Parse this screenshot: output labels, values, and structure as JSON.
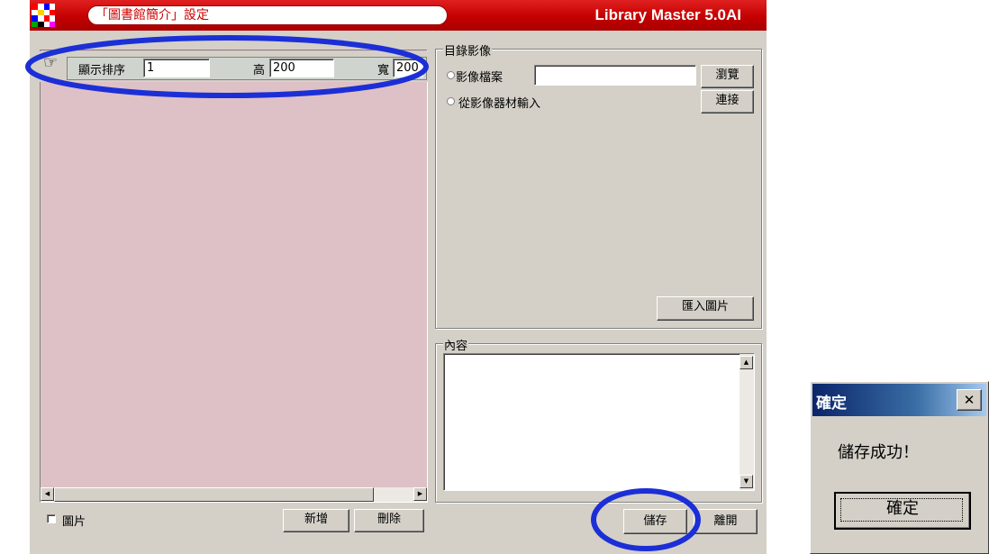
{
  "title_bar": {
    "tab_title": "「圖書館簡介」設定",
    "app_name": "Library Master 5.0AI"
  },
  "toolbar_row": {
    "order_label": "顯示排序",
    "order_value": "1",
    "height_label": "高",
    "height_value": "200",
    "width_label": "寬",
    "width_value": "200"
  },
  "left_panel": {
    "picture_checkbox_label": "圖片",
    "add_button": "新增",
    "delete_button": "刪除"
  },
  "catalog_image": {
    "legend": "目錄影像",
    "option_file": "影像檔案",
    "file_value": "",
    "browse_button": "瀏覽",
    "option_device": "從影像器材輸入",
    "connect_button": "連接",
    "import_button": "匯入圖片"
  },
  "content": {
    "legend": "內容",
    "text": ""
  },
  "footer": {
    "save_button": "儲存",
    "exit_button": "離開"
  },
  "dialog": {
    "title": "確定",
    "close_glyph": "✕",
    "message": "儲存成功！",
    "ok_button": "確定"
  },
  "colors": {
    "title_red": "#cc0000",
    "pink_panel": "#dec1c6",
    "window_gray": "#d4d0c8",
    "annotation_blue": "#1c2fd6",
    "dialog_title_blue": "#0a246a"
  }
}
